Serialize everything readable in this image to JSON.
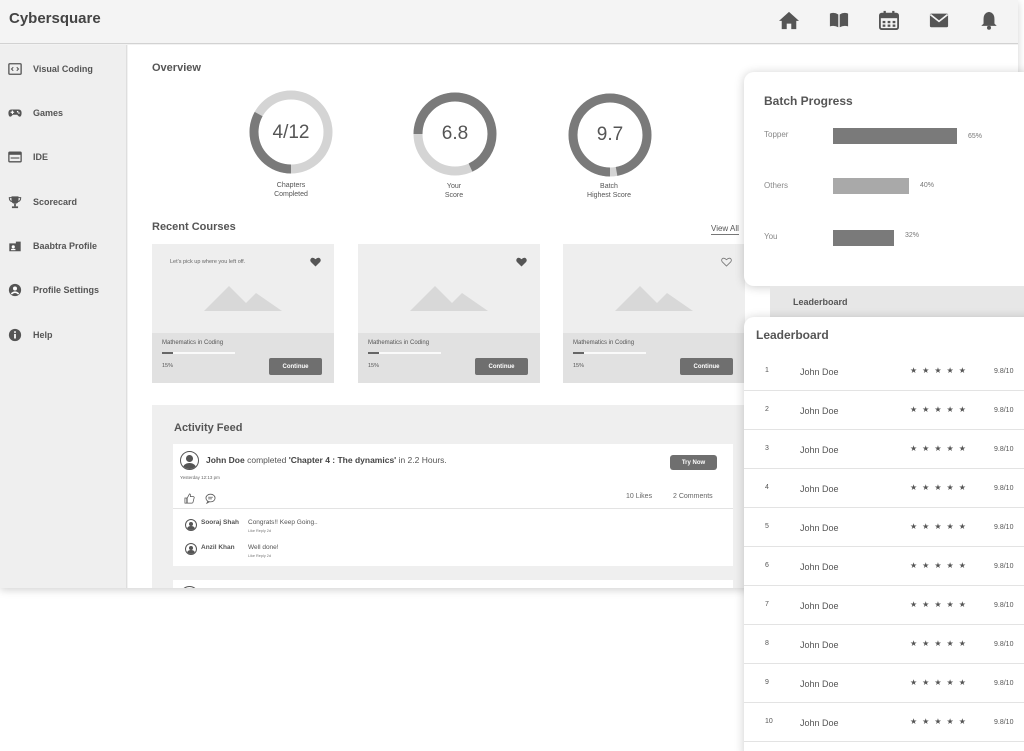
{
  "app": {
    "title": "Cybersquare"
  },
  "topnav": {
    "icons": [
      "home-icon",
      "book-icon",
      "calendar-icon",
      "mail-icon",
      "bell-icon"
    ]
  },
  "sidebar": {
    "items": [
      {
        "label": "Visual Coding",
        "icon": "code-icon"
      },
      {
        "label": "Games",
        "icon": "gamepad-icon"
      },
      {
        "label": "IDE",
        "icon": "window-icon"
      },
      {
        "label": "Scorecard",
        "icon": "trophy-icon"
      },
      {
        "label": "Baabtra Profile",
        "icon": "profile-card-icon"
      },
      {
        "label": "Profile Settings",
        "icon": "user-circle-icon"
      },
      {
        "label": "Help",
        "icon": "info-icon"
      }
    ]
  },
  "overview": {
    "title": "Overview",
    "stats": [
      {
        "value": "4/12",
        "label": "Chapters\nCompleted",
        "fraction": 0.33
      },
      {
        "value": "6.8",
        "label": "Your\nScore",
        "fraction": 0.68
      },
      {
        "value": "9.7",
        "label": "Batch\nHighest Score",
        "fraction": 0.97
      }
    ]
  },
  "recent_courses": {
    "title": "Recent Courses",
    "view_all": "View All",
    "cards": [
      {
        "resume": "Let's pick up where you left off.",
        "title": "Mathematics in Coding",
        "progress_label": "15%",
        "progress": 0.15,
        "button": "Continue",
        "favorited": true
      },
      {
        "resume": "",
        "title": "Mathematics in Coding",
        "progress_label": "15%",
        "progress": 0.15,
        "button": "Continue",
        "favorited": true
      },
      {
        "resume": "",
        "title": "Mathematics in Coding",
        "progress_label": "15%",
        "progress": 0.15,
        "button": "Continue",
        "favorited": false
      }
    ]
  },
  "activity_feed": {
    "title": "Activity Feed",
    "post": {
      "user": "John Doe",
      "verb": "completed",
      "item": "'Chapter 4 : The dynamics'",
      "suffix": "in 2.2 Hours.",
      "time": "Yesterday 12:13 pm",
      "button": "Try Now",
      "likes": "10 Likes",
      "comments": "2 Comments",
      "replies": [
        {
          "name": "Sooraj Shah",
          "text": "Congrats!! Keep Going..",
          "meta": "Like   Reply   2d"
        },
        {
          "name": "Anzil Khan",
          "text": "Well done!",
          "meta": "Like   Reply   2d"
        }
      ]
    }
  },
  "batch_progress": {
    "title": "Batch Progress",
    "rows": [
      {
        "label": "Topper",
        "value": 65,
        "pct": "65%",
        "color": "#7a7a7a"
      },
      {
        "label": "Others",
        "value": 40,
        "pct": "40%",
        "color": "#a9a9a9"
      },
      {
        "label": "You",
        "value": 32,
        "pct": "32%",
        "color": "#7a7a7a"
      }
    ]
  },
  "leaderboard": {
    "tab_label": "Leaderboard",
    "title": "Leaderboard",
    "rows": [
      {
        "rank": "1",
        "name": "John Doe",
        "stars": "★★★★★",
        "score": "9.8/10"
      },
      {
        "rank": "2",
        "name": "John Doe",
        "stars": "★★★★★",
        "score": "9.8/10"
      },
      {
        "rank": "3",
        "name": "John Doe",
        "stars": "★★★★★",
        "score": "9.8/10"
      },
      {
        "rank": "4",
        "name": "John Doe",
        "stars": "★★★★★",
        "score": "9.8/10"
      },
      {
        "rank": "5",
        "name": "John Doe",
        "stars": "★★★★★",
        "score": "9.8/10"
      },
      {
        "rank": "6",
        "name": "John Doe",
        "stars": "★★★★★",
        "score": "9.8/10"
      },
      {
        "rank": "7",
        "name": "John Doe",
        "stars": "★★★★★",
        "score": "9.8/10"
      },
      {
        "rank": "8",
        "name": "John Doe",
        "stars": "★★★★★",
        "score": "9.8/10"
      },
      {
        "rank": "9",
        "name": "John Doe",
        "stars": "★★★★★",
        "score": "9.8/10"
      },
      {
        "rank": "10",
        "name": "John Doe",
        "stars": "★★★★★",
        "score": "9.8/10"
      }
    ]
  },
  "colors": {
    "accent": "#6f6f6f",
    "track": "#d4d4d4",
    "fill": "#7a7a7a"
  }
}
